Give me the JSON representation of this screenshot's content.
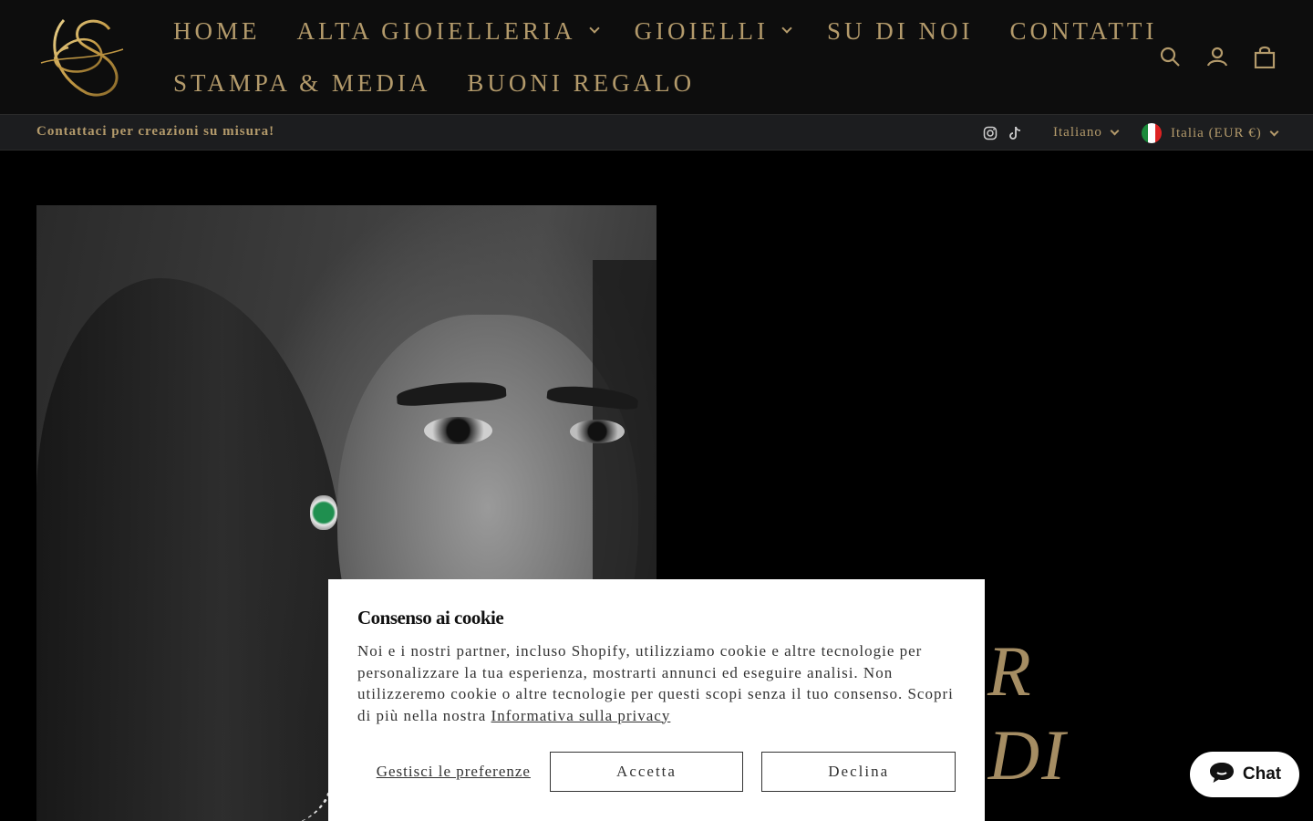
{
  "brand": {
    "logo_monogram": "DS"
  },
  "nav": {
    "row1": [
      {
        "label": "HOME",
        "dropdown": false
      },
      {
        "label": "ALTA GIOIELLERIA",
        "dropdown": true
      },
      {
        "label": "GIOIELLI",
        "dropdown": true
      },
      {
        "label": "SU DI NOI",
        "dropdown": false
      },
      {
        "label": "CONTATTI",
        "dropdown": false
      }
    ],
    "row2": [
      {
        "label": "STAMPA & MEDIA",
        "dropdown": false
      },
      {
        "label": "BUONI REGALO",
        "dropdown": false
      }
    ]
  },
  "header_icons": [
    "search-icon",
    "account-icon",
    "cart-icon"
  ],
  "announcement": {
    "text": "Contattaci per creazioni su misura!",
    "social": [
      "instagram-icon",
      "tiktok-icon"
    ],
    "language": "Italiano",
    "currency": "Italia (EUR €)"
  },
  "hero": {
    "line1": "LIER",
    "line2": "TO DI"
  },
  "cookie": {
    "title": "Consenso ai cookie",
    "body": "Noi e i nostri partner, incluso Shopify, utilizziamo cookie e altre tecnologie per personalizzare la tua esperienza, mostrarti annunci ed eseguire analisi. Non utilizzeremo cookie o altre tecnologie per questi scopi senza il tuo consenso. Scopri di più nella nostra ",
    "privacy_link": "Informativa sulla privacy",
    "manage": "Gestisci le preferenze",
    "accept": "Accetta",
    "decline": "Declina"
  },
  "chat": {
    "label": "Chat"
  },
  "colors": {
    "gold": "#b39a6b",
    "header_bg": "#0d0d0d",
    "bar_bg": "#1c1d1f"
  }
}
